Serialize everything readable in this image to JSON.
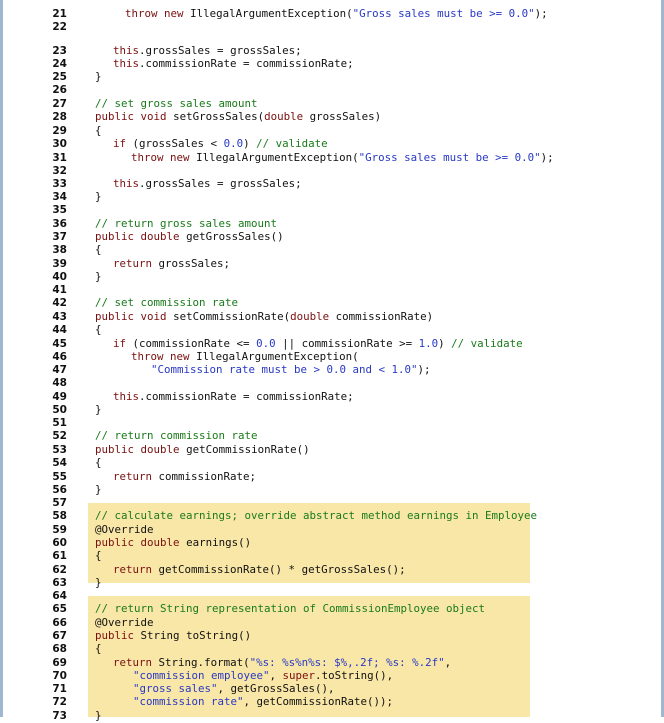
{
  "lines": [
    {
      "num": "21",
      "text": "throw new IllegalArgumentException(\"Gross sales must be >= 0.0\");"
    },
    {
      "num": "22",
      "text": ""
    },
    {
      "num": "23",
      "text": "this.grossSales = grossSales;"
    },
    {
      "num": "24",
      "text": "this.commissionRate = commissionRate;"
    },
    {
      "num": "25",
      "text": "}"
    },
    {
      "num": "26",
      "text": ""
    },
    {
      "num": "27",
      "text": "// set gross sales amount"
    },
    {
      "num": "28",
      "text": "public void setGrossSales(double grossSales)"
    },
    {
      "num": "29",
      "text": "{"
    },
    {
      "num": "30",
      "text": "if (grossSales < 0.0) // validate"
    },
    {
      "num": "31",
      "text": "throw new IllegalArgumentException(\"Gross sales must be >= 0.0\");"
    },
    {
      "num": "32",
      "text": ""
    },
    {
      "num": "33",
      "text": "this.grossSales = grossSales;"
    },
    {
      "num": "34",
      "text": "}"
    },
    {
      "num": "35",
      "text": ""
    },
    {
      "num": "36",
      "text": "// return gross sales amount"
    },
    {
      "num": "37",
      "text": "public double getGrossSales()"
    },
    {
      "num": "38",
      "text": "{"
    },
    {
      "num": "39",
      "text": "return grossSales;"
    },
    {
      "num": "40",
      "text": "}"
    },
    {
      "num": "41",
      "text": ""
    },
    {
      "num": "42",
      "text": "// set commission rate"
    },
    {
      "num": "43",
      "text": "public void setCommissionRate(double commissionRate)"
    },
    {
      "num": "44",
      "text": "{"
    },
    {
      "num": "45",
      "text": "if (commissionRate <= 0.0 || commissionRate >= 1.0) // validate"
    },
    {
      "num": "46",
      "text": "throw new IllegalArgumentException("
    },
    {
      "num": "47",
      "text": "\"Commission rate must be > 0.0 and < 1.0\");"
    },
    {
      "num": "48",
      "text": ""
    },
    {
      "num": "49",
      "text": "this.commissionRate = commissionRate;"
    },
    {
      "num": "50",
      "text": "}"
    },
    {
      "num": "51",
      "text": ""
    },
    {
      "num": "52",
      "text": "// return commission rate"
    },
    {
      "num": "53",
      "text": "public double getCommissionRate()"
    },
    {
      "num": "54",
      "text": "{"
    },
    {
      "num": "55",
      "text": "return commissionRate;"
    },
    {
      "num": "56",
      "text": "}"
    },
    {
      "num": "57",
      "text": ""
    },
    {
      "num": "58",
      "text": "// calculate earnings; override abstract method earnings in Employee"
    },
    {
      "num": "59",
      "text": "@Override"
    },
    {
      "num": "60",
      "text": "public double earnings()"
    },
    {
      "num": "61",
      "text": "{"
    },
    {
      "num": "62",
      "text": "return getCommissionRate() * getGrossSales();"
    },
    {
      "num": "63",
      "text": "}"
    },
    {
      "num": "64",
      "text": ""
    },
    {
      "num": "65",
      "text": "// return String representation of CommissionEmployee object"
    },
    {
      "num": "66",
      "text": "@Override"
    },
    {
      "num": "67",
      "text": "public String toString()"
    },
    {
      "num": "68",
      "text": "{"
    },
    {
      "num": "69",
      "text": "return String.format(\"%s: %s%n%s: $%,.2f; %s: %.2f\","
    },
    {
      "num": "70",
      "text": "\"commission employee\", super.toString(),"
    },
    {
      "num": "71",
      "text": "\"gross sales\", getGrossSales(),"
    },
    {
      "num": "72",
      "text": "\"commission rate\", getCommissionRate());"
    },
    {
      "num": "73",
      "text": "}"
    }
  ]
}
